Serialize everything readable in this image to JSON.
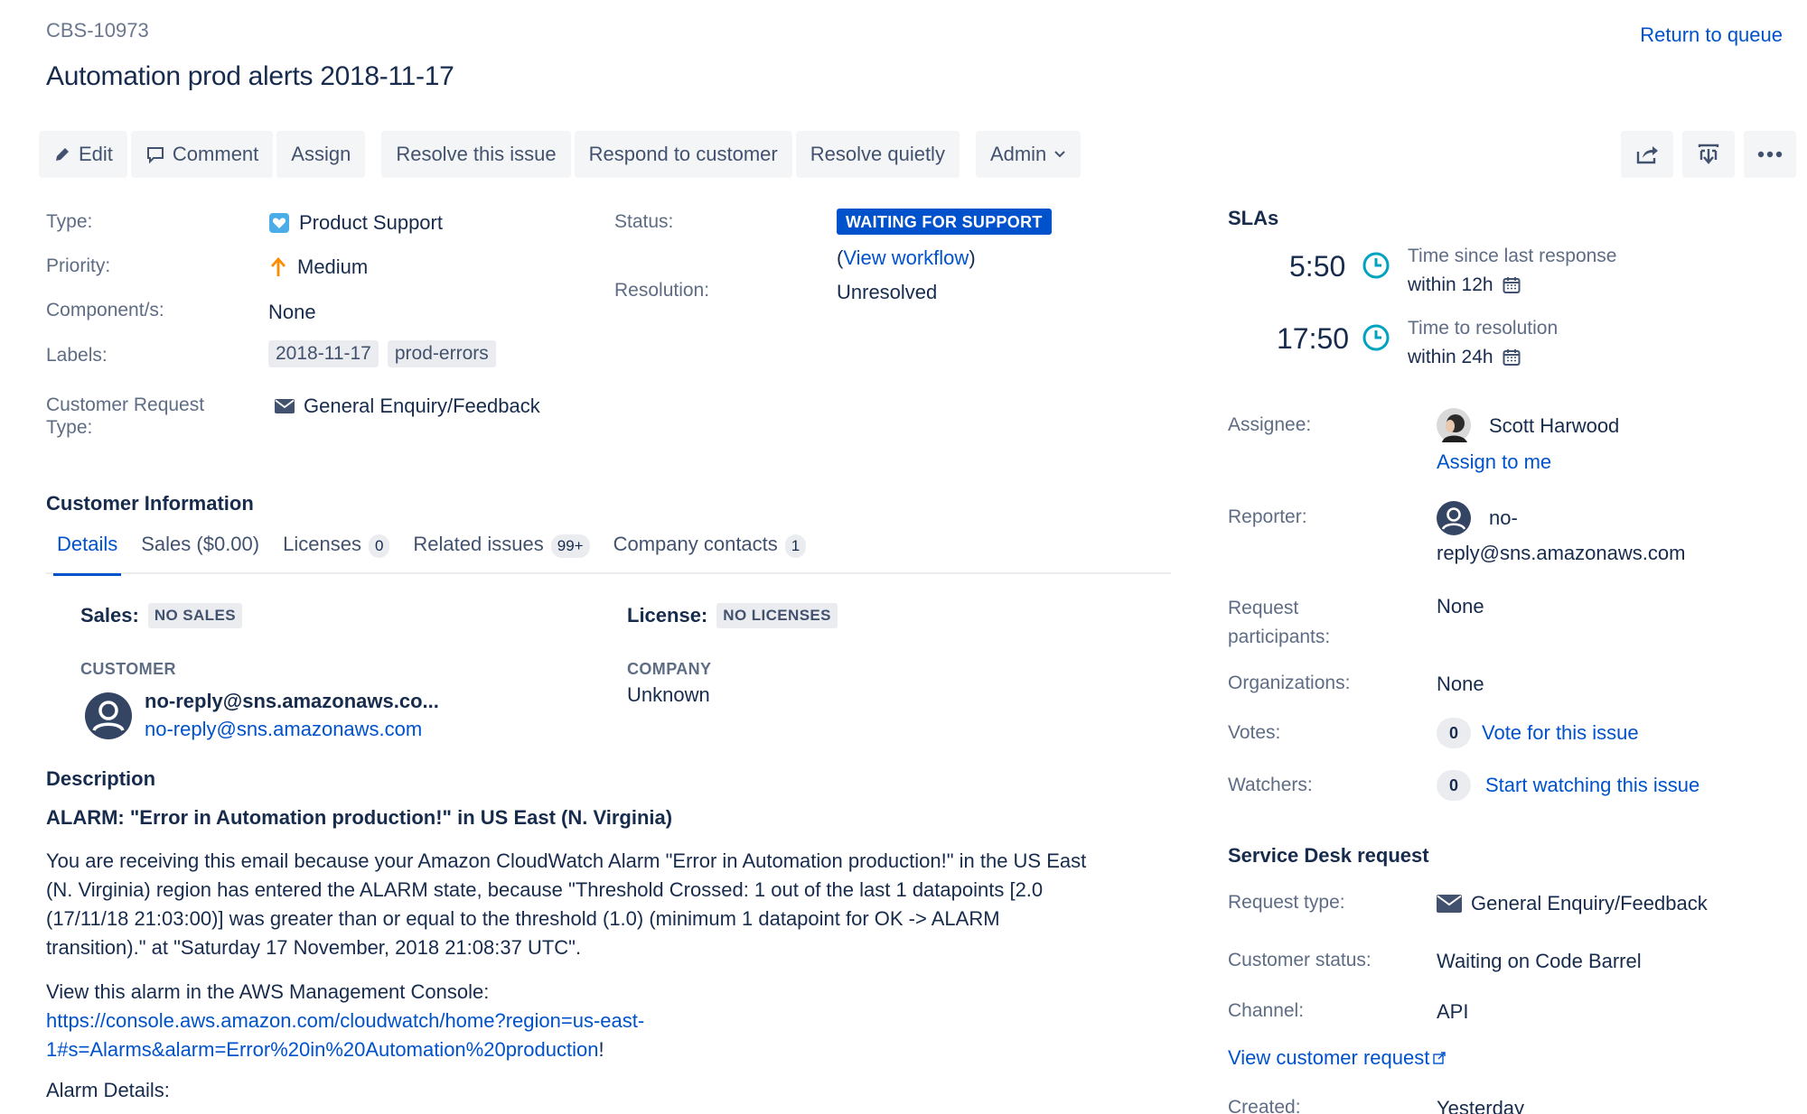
{
  "header": {
    "issue_key": "CBS-10973",
    "title": "Automation prod alerts 2018-11-17",
    "return_link": "Return to queue"
  },
  "toolbar": {
    "edit": "Edit",
    "comment": "Comment",
    "assign": "Assign",
    "resolve_issue": "Resolve this issue",
    "respond": "Respond to customer",
    "resolve_quietly": "Resolve quietly",
    "admin": "Admin"
  },
  "details": {
    "type_label": "Type:",
    "type_value": "Product Support",
    "priority_label": "Priority:",
    "priority_value": "Medium",
    "components_label": "Component/s:",
    "components_value": "None",
    "labels_label": "Labels:",
    "labels": [
      "2018-11-17",
      "prod-errors"
    ],
    "crt_label_1": "Customer Request",
    "crt_label_2": "Type:",
    "crt_value": "General Enquiry/Feedback",
    "status_label": "Status:",
    "status_value": "WAITING FOR SUPPORT",
    "workflow_open": "(",
    "workflow_link": "View workflow",
    "workflow_close": ")",
    "resolution_label": "Resolution:",
    "resolution_value": "Unresolved"
  },
  "customer_info": {
    "heading": "Customer Information",
    "tabs": [
      {
        "label": "Details",
        "count": ""
      },
      {
        "label": "Sales ($0.00)",
        "count": ""
      },
      {
        "label": "Licenses",
        "count": "0"
      },
      {
        "label": "Related issues",
        "count": "99+"
      },
      {
        "label": "Company contacts",
        "count": "1"
      }
    ],
    "sales_label": "Sales:",
    "sales_value": "NO SALES",
    "license_label": "License:",
    "license_value": "NO LICENSES",
    "customer_heading": "CUSTOMER",
    "customer_name": "no-reply@sns.amazonaws.co...",
    "customer_email": "no-reply@sns.amazonaws.com",
    "company_heading": "COMPANY",
    "company_value": "Unknown"
  },
  "description": {
    "heading": "Description",
    "alarm_title": "ALARM: \"Error in Automation production!\" in US East (N. Virginia)",
    "para1_l1": "You are receiving this email because your Amazon CloudWatch Alarm \"Error in Automation production!\" in the US East",
    "para1_l2": "(N. Virginia) region has entered the ALARM state, because \"Threshold Crossed: 1 out of the last 1 datapoints [2.0",
    "para1_l3": "(17/11/18 21:03:00)] was greater than or equal to the threshold (1.0) (minimum 1 datapoint for OK -> ALARM",
    "para1_l4": "transition).\" at \"Saturday 17 November, 2018 21:08:37 UTC\".",
    "console_text": "View this alarm in the AWS Management Console:",
    "console_link_l1": "https://console.aws.amazon.com/cloudwatch/home?region=us-east-",
    "console_link_l2": "1#s=Alarms&alarm=Error%20in%20Automation%20production",
    "console_bang": "!",
    "alarm_details": "Alarm Details:"
  },
  "slas": {
    "heading": "SLAs",
    "items": [
      {
        "time": "5:50",
        "name": "Time since last response",
        "goal": "within 12h"
      },
      {
        "time": "17:50",
        "name": "Time to resolution",
        "goal": "within 24h"
      }
    ]
  },
  "people": {
    "assignee_label": "Assignee:",
    "assignee_name": "Scott Harwood",
    "assign_to_me": "Assign to me",
    "reporter_label": "Reporter:",
    "reporter_l1": "no-",
    "reporter_l2": "reply@sns.amazonaws.com",
    "participants_label_1": "Request",
    "participants_label_2": "participants:",
    "participants_value": "None",
    "orgs_label": "Organizations:",
    "orgs_value": "None",
    "votes_label": "Votes:",
    "votes_count": "0",
    "votes_link": "Vote for this issue",
    "watchers_label": "Watchers:",
    "watchers_count": "0",
    "watchers_link": "Start watching this issue"
  },
  "service_desk": {
    "heading": "Service Desk request",
    "request_type_label": "Request type:",
    "request_type_value": "General Enquiry/Feedback",
    "customer_status_label": "Customer status:",
    "customer_status_value": "Waiting on Code Barrel",
    "channel_label": "Channel:",
    "channel_value": "API",
    "view_request": "View customer request",
    "created_label": "Created:",
    "created_value": "Yesterday"
  },
  "colors": {
    "accent": "#0052cc",
    "sla_green": "#00a3bf",
    "priority_orange": "#ff8b00",
    "type_blue": "#4bade8"
  }
}
